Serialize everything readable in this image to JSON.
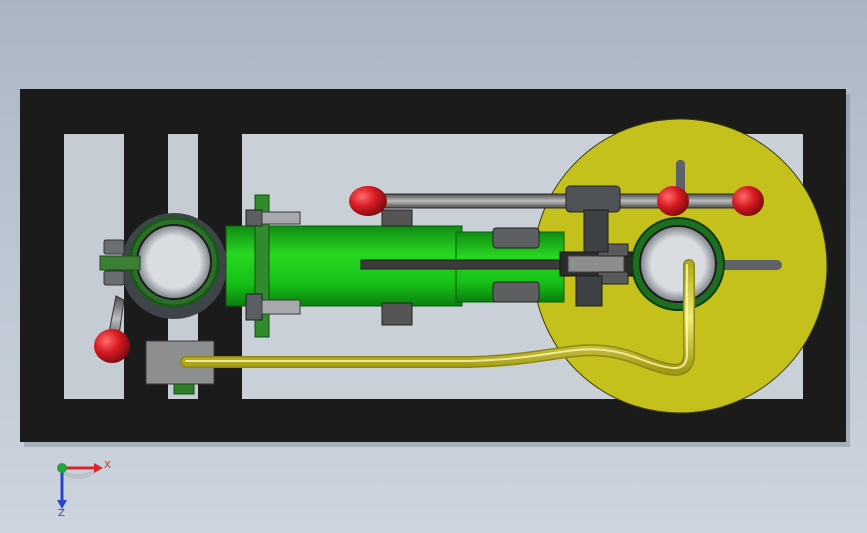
{
  "app": {
    "type": "cad-3d-viewport"
  },
  "scene": {
    "background_top": "#aab5c4",
    "background_bottom": "#ccd4de",
    "colors": {
      "frame": "#1b1b1b",
      "frame_slot": "#c6ccd3",
      "cylinder_green": "#22d41c",
      "disc_olive": "#c9c521",
      "pipe_yellow": "#e6e04a",
      "knob_red": "#d61b22",
      "rod_grey": "#8c8c8c",
      "nut_grey": "#6e6e6e"
    },
    "parts": [
      {
        "name": "base-frame"
      },
      {
        "name": "flywheel-disc"
      },
      {
        "name": "green-cylinder"
      },
      {
        "name": "left-bearing-ring"
      },
      {
        "name": "right-bearing-ring"
      },
      {
        "name": "piston-rod"
      },
      {
        "name": "control-lever"
      },
      {
        "name": "steam-pipe"
      }
    ]
  },
  "triad": {
    "x_label": "X",
    "z_label": "Z",
    "x_color": "#d8262b",
    "y_color": "#25a33a",
    "z_color": "#2a44c9"
  }
}
